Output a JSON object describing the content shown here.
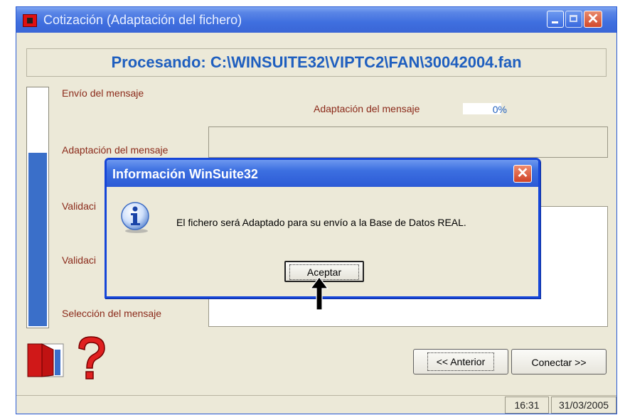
{
  "window": {
    "title": "Cotización (Adaptación del fichero)",
    "close_glyph": "✕"
  },
  "header": {
    "processing_text": "Procesando: C:\\WINSUITE32\\VIPTC2\\FAN\\30042004.fan"
  },
  "progress": {
    "fill_fraction": 0.73
  },
  "steps": [
    "Envío del mensaje",
    "Adaptación del mensaje",
    "Validaci",
    "Validaci",
    "Selección del mensaje"
  ],
  "adaptation": {
    "label": "Adaptación del mensaje",
    "percent": "0%"
  },
  "buttons": {
    "back": "<< Anterior",
    "next": "Conectar >>"
  },
  "status": {
    "time": "16:31",
    "date": "31/03/2005"
  },
  "icons": {
    "exit": "door-exit-icon",
    "help": "question-mark-icon",
    "info": "info-icon"
  },
  "dialog": {
    "title": "Información WinSuite32",
    "close_glyph": "✕",
    "message": "El fichero será Adaptado para su envío a la Base de Datos REAL.",
    "ok_label": "Aceptar"
  },
  "colors": {
    "accent": "#1f5fbf",
    "step_text": "#8b2a1a",
    "progress_fill": "#3a6fc9"
  }
}
